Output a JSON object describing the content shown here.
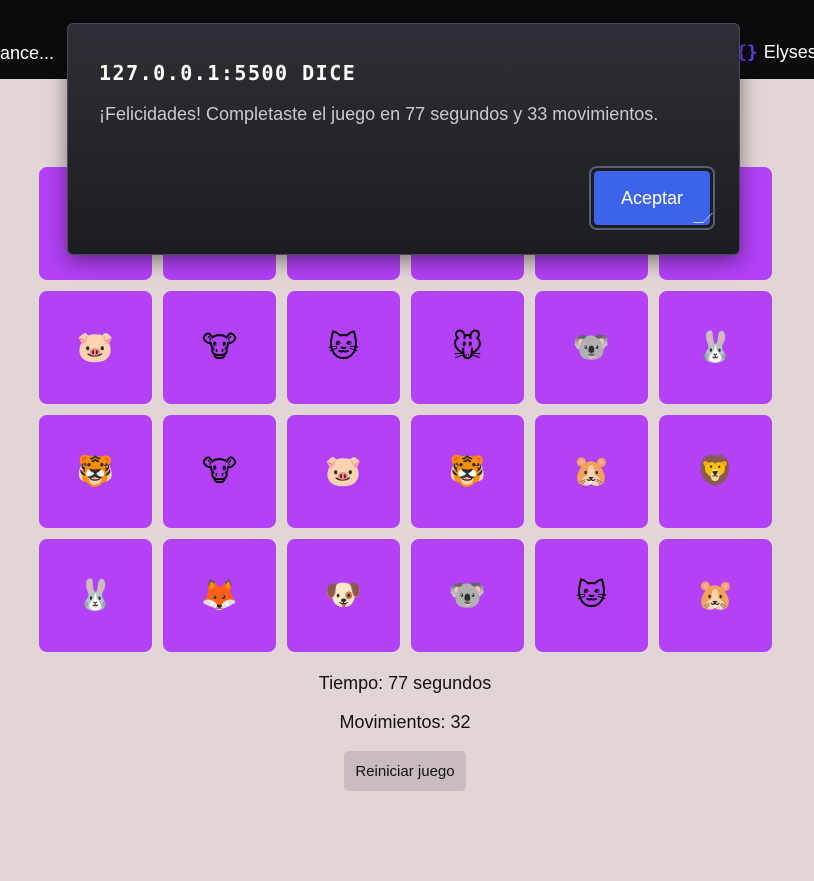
{
  "topbar": {
    "left_text": "ance...",
    "right_icon": "curly-braces-icon",
    "right_text": "Elyses"
  },
  "grid": {
    "cards": [
      {
        "emoji": "",
        "name": "hidden"
      },
      {
        "emoji": "",
        "name": "hidden"
      },
      {
        "emoji": "",
        "name": "hidden"
      },
      {
        "emoji": "",
        "name": "hidden"
      },
      {
        "emoji": "",
        "name": "hidden"
      },
      {
        "emoji": "",
        "name": "hidden"
      },
      {
        "emoji": "🐷",
        "name": "pig"
      },
      {
        "emoji": "🐮",
        "name": "cow"
      },
      {
        "emoji": "🐱",
        "name": "cat"
      },
      {
        "emoji": "🐭",
        "name": "mouse"
      },
      {
        "emoji": "🐨",
        "name": "koala"
      },
      {
        "emoji": "🐰",
        "name": "rabbit"
      },
      {
        "emoji": "🐯",
        "name": "tiger"
      },
      {
        "emoji": "🐮",
        "name": "cow"
      },
      {
        "emoji": "🐷",
        "name": "pig"
      },
      {
        "emoji": "🐯",
        "name": "tiger"
      },
      {
        "emoji": "🐹",
        "name": "hamster"
      },
      {
        "emoji": "🦁",
        "name": "lion"
      },
      {
        "emoji": "🐰",
        "name": "rabbit"
      },
      {
        "emoji": "🦊",
        "name": "fox"
      },
      {
        "emoji": "🐶",
        "name": "dog"
      },
      {
        "emoji": "🐨",
        "name": "koala"
      },
      {
        "emoji": "🐱",
        "name": "cat"
      },
      {
        "emoji": "🐹",
        "name": "hamster"
      }
    ]
  },
  "stats": {
    "time": "Tiempo: 77 segundos",
    "moves": "Movimientos: 32"
  },
  "reset_label": "Reiniciar juego",
  "dialog": {
    "title": "127.0.0.1:5500 DICE",
    "message": "¡Felicidades! Completaste el juego en 77 segundos y 33 movimientos.",
    "accept_label": "Aceptar"
  },
  "colors": {
    "page_bg": "#e2d5d6",
    "card": "#b341f7",
    "accept": "#3d63ea"
  }
}
